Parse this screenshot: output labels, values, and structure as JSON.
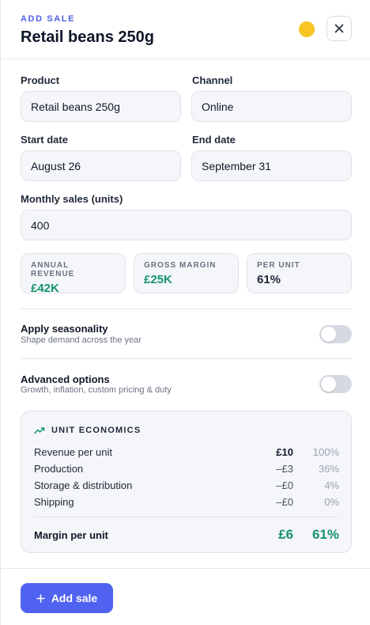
{
  "header": {
    "eyebrow": "ADD SALE",
    "title": "Retail beans 250g",
    "status_color": "#f8c523",
    "close_icon": "close-icon"
  },
  "form": {
    "product": {
      "label": "Product",
      "value": "Retail beans 250g"
    },
    "channel": {
      "label": "Channel",
      "value": "Online"
    },
    "start_date": {
      "label": "Start date",
      "value": "August 26"
    },
    "end_date": {
      "label": "End date",
      "value": "September 31"
    },
    "monthly_sales": {
      "label": "Monthly sales (units)",
      "value": "400"
    }
  },
  "stats": [
    {
      "label": "ANNUAL REVENUE",
      "value": "£42K",
      "color": "#17946b"
    },
    {
      "label": "GROSS MARGIN",
      "value": "£25K",
      "color": "#17946b"
    },
    {
      "label": "PER UNIT",
      "value": "61%",
      "color": "#1f2937"
    }
  ],
  "options": {
    "seasonality": {
      "title": "Apply seasonality",
      "description": "Shape demand across the year",
      "enabled": false
    },
    "advanced": {
      "title": "Advanced options",
      "description": "Growth, inflation, custom pricing & duty",
      "enabled": false
    }
  },
  "unit_economics": {
    "title": "UNIT ECONOMICS",
    "icon": "trending-up-icon",
    "rows": [
      {
        "name": "Revenue per unit",
        "amount": "£10",
        "percent": "100%"
      },
      {
        "name": "Production",
        "amount": "–£3",
        "percent": "36%"
      },
      {
        "name": "Storage & distribution",
        "amount": "–£0",
        "percent": "4%"
      },
      {
        "name": "Shipping",
        "amount": "–£0",
        "percent": "0%"
      }
    ],
    "total": {
      "name": "Margin per unit",
      "amount": "£6",
      "percent": "61%"
    }
  },
  "footer": {
    "add_label": "Add sale",
    "add_icon": "plus-icon",
    "accent": "#4f63f0"
  }
}
